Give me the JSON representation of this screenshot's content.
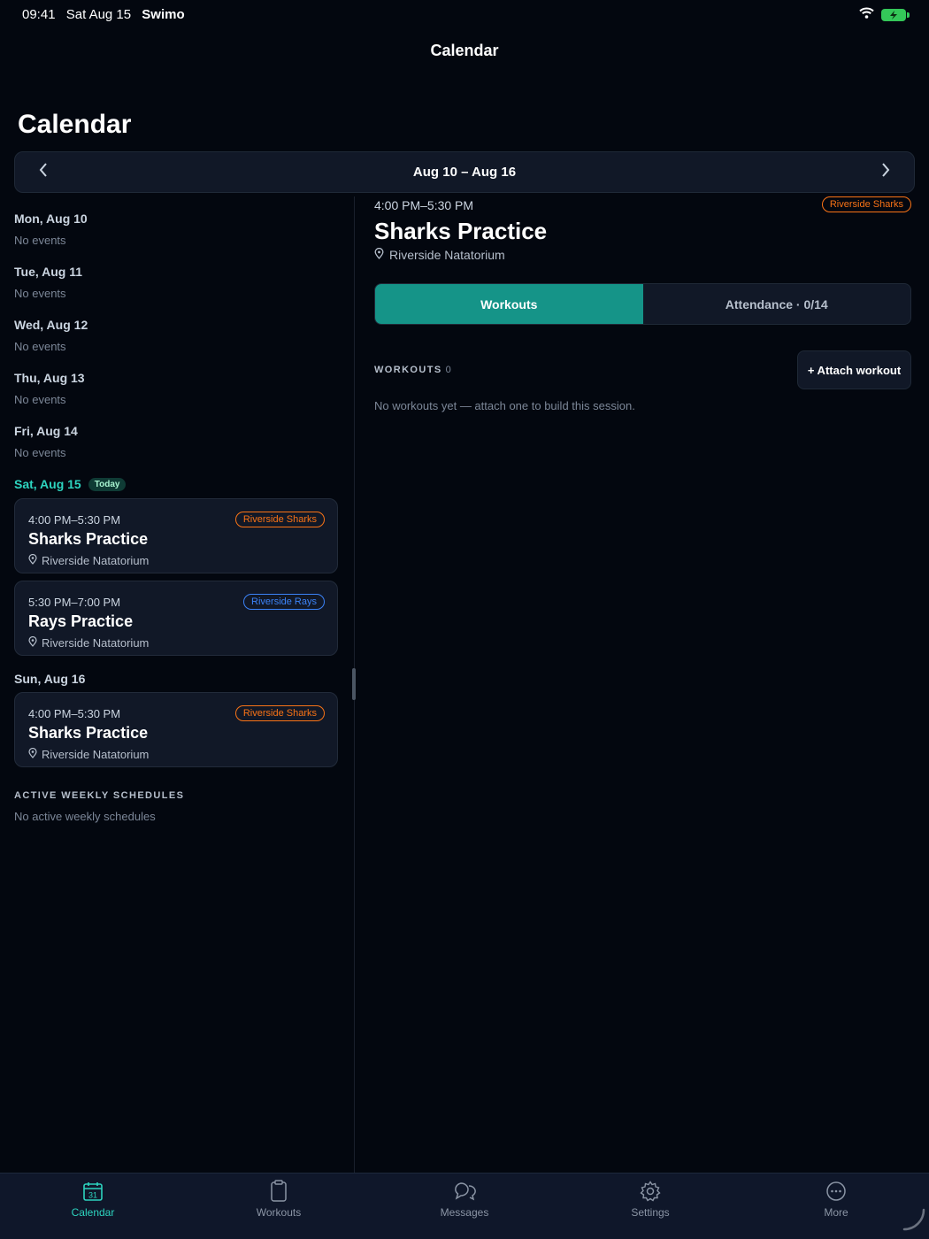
{
  "status_bar": {
    "time": "09:41",
    "date": "Sat Aug 15",
    "app": "Swimo"
  },
  "nav": {
    "title": "Calendar",
    "large_title": "Calendar"
  },
  "week": {
    "label": "Aug 10 – Aug 16"
  },
  "days": [
    {
      "label": "Mon, Aug 10",
      "empty": "No events"
    },
    {
      "label": "Tue, Aug 11",
      "empty": "No events"
    },
    {
      "label": "Wed, Aug 12",
      "empty": "No events"
    },
    {
      "label": "Thu, Aug 13",
      "empty": "No events"
    },
    {
      "label": "Fri, Aug 14",
      "empty": "No events"
    },
    {
      "label": "Sat, Aug 15",
      "badge": "Today"
    },
    {
      "label": "Sun, Aug 16"
    }
  ],
  "events": [
    {
      "time": "4:00 PM–5:30 PM",
      "title": "Sharks Practice",
      "location": "Riverside Natatorium",
      "team": "Riverside Sharks"
    },
    {
      "time": "5:30 PM–7:00 PM",
      "title": "Rays Practice",
      "location": "Riverside Natatorium",
      "team": "Riverside Rays"
    },
    {
      "time": "4:00 PM–5:30 PM",
      "title": "Sharks Practice",
      "location": "Riverside Natatorium",
      "team": "Riverside Sharks"
    }
  ],
  "weekly_schedules": {
    "heading": "ACTIVE WEEKLY SCHEDULES",
    "empty": "No active weekly schedules"
  },
  "detail": {
    "time": "4:00 PM–5:30 PM",
    "team": "Riverside Sharks",
    "title": "Sharks Practice",
    "location": "Riverside Natatorium",
    "tabs": [
      "Workouts",
      "Attendance · 0/14"
    ],
    "workouts_label": "WORKOUTS",
    "workouts_count": "0",
    "attach_label": "+ Attach workout",
    "empty": "No workouts yet — attach one to build this session."
  },
  "tab_bar": [
    {
      "label": "Calendar",
      "icon": "calendar-icon",
      "icon_text": "31"
    },
    {
      "label": "Workouts",
      "icon": "clipboard-icon"
    },
    {
      "label": "Messages",
      "icon": "chat-bubbles-icon"
    },
    {
      "label": "Settings",
      "icon": "gear-icon"
    },
    {
      "label": "More",
      "icon": "ellipsis-circle-icon"
    }
  ],
  "colors": {
    "accent": "#159488",
    "teal_text": "#2dd4bf",
    "sharks": "#f97316",
    "rays": "#3b82f6",
    "background": "#03070f",
    "card": "#111827"
  }
}
